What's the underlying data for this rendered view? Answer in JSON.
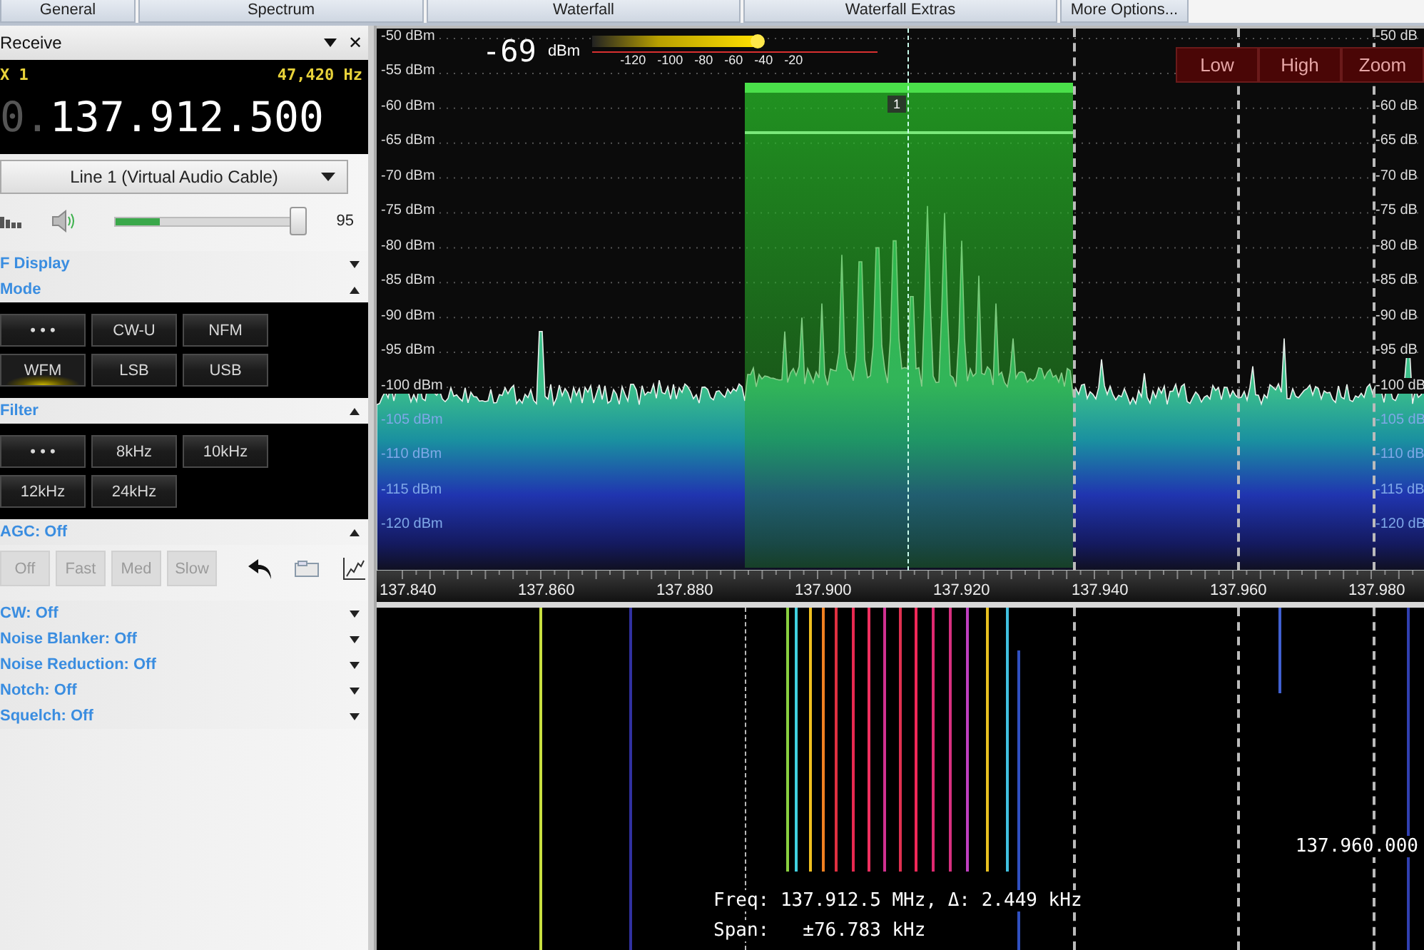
{
  "tabs": [
    "General",
    "Spectrum",
    "Waterfall",
    "Waterfall Extras",
    "More Options..."
  ],
  "receive": {
    "title": "Receive",
    "close_glyph": "✕",
    "rx_label": "X 1",
    "offset": "47,420 Hz",
    "frequency_prefix": "0.",
    "frequency": "137.912.500",
    "audio_device": "Line 1 (Virtual Audio Cable)",
    "audio_meter": {
      "level": 0.24
    },
    "volume": {
      "level": 0.95,
      "reading": "95"
    }
  },
  "sections": [
    {
      "kind": "header",
      "title": "F Display",
      "expanded": false
    },
    {
      "kind": "buttons",
      "title": "Mode",
      "expanded": true,
      "buttons": [
        {
          "label": "• • •",
          "selected": false
        },
        {
          "label": "CW-U",
          "selected": false
        },
        {
          "label": "NFM",
          "selected": false
        },
        {
          "label": "WFM",
          "selected": true
        },
        {
          "label": "LSB",
          "selected": false
        },
        {
          "label": "USB",
          "selected": false
        }
      ]
    },
    {
      "kind": "buttons",
      "title": "Filter",
      "expanded": true,
      "buttons": [
        {
          "label": "• • •",
          "selected": false
        },
        {
          "label": "8kHz",
          "selected": false
        },
        {
          "label": "10kHz",
          "selected": false
        },
        {
          "label": "12kHz",
          "selected": false
        },
        {
          "label": "24kHz",
          "selected": false
        }
      ]
    },
    {
      "kind": "agc",
      "title": "AGC: Off",
      "expanded": true,
      "buttons": [
        {
          "label": "Off",
          "disabled": true
        },
        {
          "label": "Fast",
          "disabled": true
        },
        {
          "label": "Med",
          "disabled": true
        },
        {
          "label": "Slow",
          "disabled": true
        }
      ]
    },
    {
      "kind": "header",
      "title": "CW: Off",
      "expanded": false
    },
    {
      "kind": "header",
      "title": "Noise Blanker: Off",
      "expanded": false
    },
    {
      "kind": "header",
      "title": "Noise Reduction: Off",
      "expanded": false
    },
    {
      "kind": "header",
      "title": "Notch: Off",
      "expanded": false
    },
    {
      "kind": "header",
      "title": "Squelch: Off",
      "expanded": false
    }
  ],
  "spectrum": {
    "signal": {
      "reading": "-69",
      "unit": "dBm",
      "level": 0.58,
      "ticks": [
        "-120",
        "-100",
        "-80",
        "-60",
        "-40",
        "-20"
      ]
    },
    "buttons": [
      "Low",
      "High",
      "Zoom"
    ],
    "y_labels_left": [
      "-50 dBm",
      "-55 dBm",
      "-60 dBm",
      "-65 dBm",
      "-70 dBm",
      "-75 dBm",
      "-80 dBm",
      "-85 dBm",
      "-90 dBm",
      "-95 dBm",
      "-100 dBm",
      "-105 dBm",
      "-110 dBm",
      "-115 dBm",
      "-120 dBm"
    ],
    "y_label_right_top": "-50 dB",
    "y_labels_right": [
      "-60 dB",
      "-65 dB",
      "-70 dB",
      "-75 dB",
      "-80 dB",
      "-85 dB",
      "-90 dB",
      "-95 dB",
      "-100 dB",
      "-105 dB",
      "-110 dB",
      "-115 dB",
      "-120 dB"
    ],
    "x_labels": [
      "137.840",
      "137.860",
      "137.880",
      "137.900",
      "137.920",
      "137.940",
      "137.960",
      "137.980"
    ],
    "filter_marker": "1"
  },
  "waterfall": {
    "cursor_frequency": "137.960.000",
    "info": [
      "Freq: 137.912.5 MHz, Δ: 2.449 kHz",
      "Span:   ±76.783 kHz"
    ]
  }
}
